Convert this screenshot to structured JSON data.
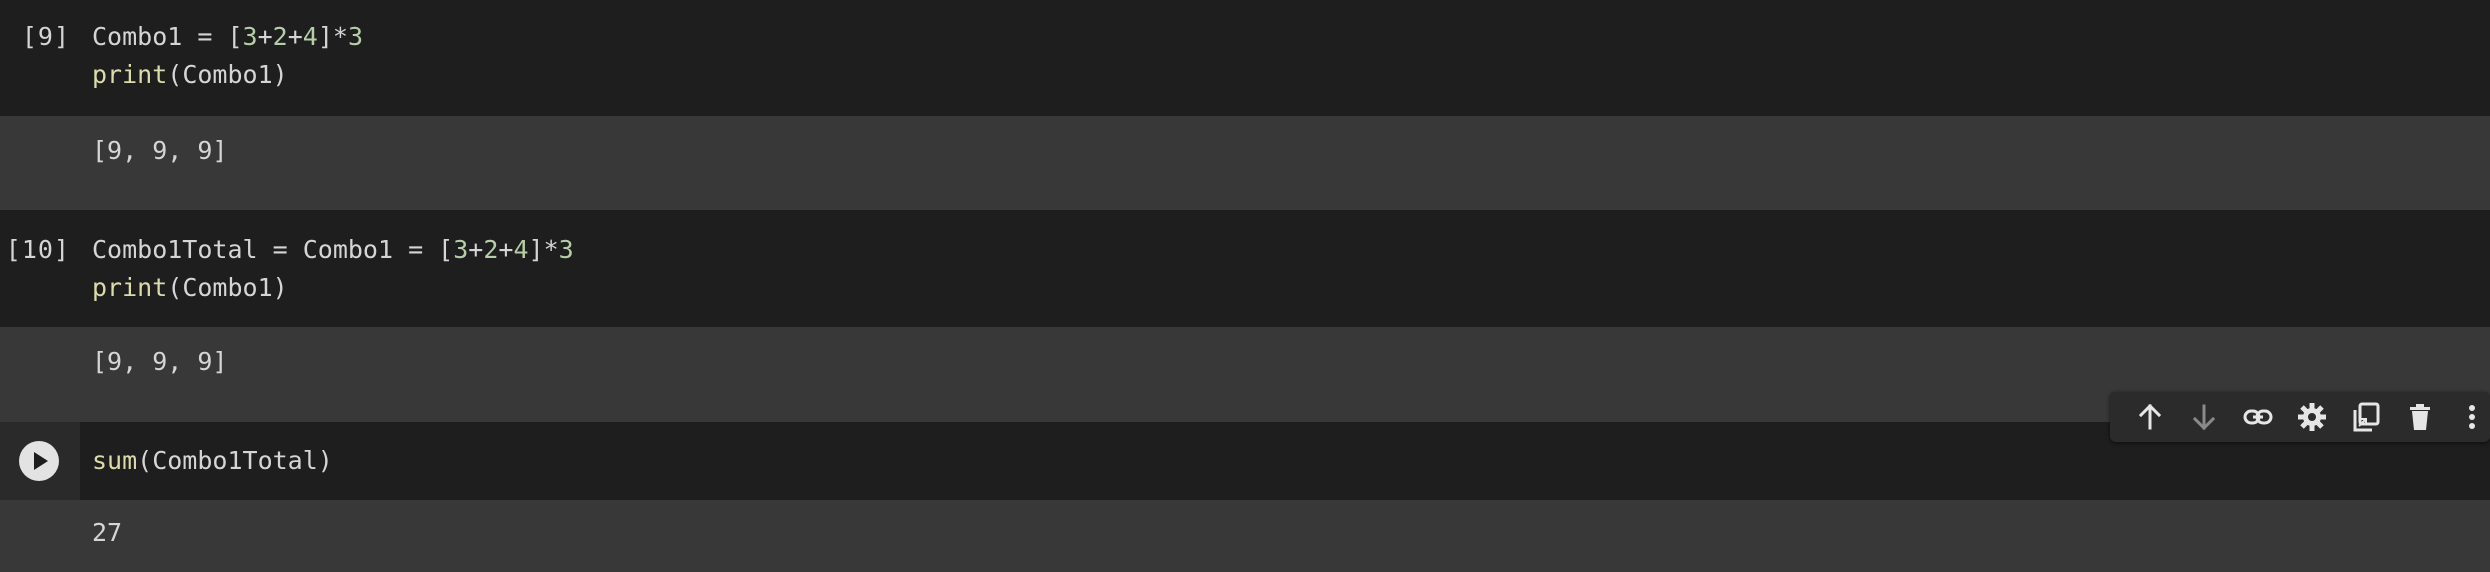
{
  "cells": [
    {
      "exec_count": "[9]",
      "lines": [
        [
          "Combo1 = [",
          "3",
          "+",
          "2",
          "+",
          "4",
          "]*",
          "3"
        ],
        [
          "print",
          "(Combo1)"
        ]
      ],
      "output": "[9, 9, 9]"
    },
    {
      "exec_count": "[10]",
      "lines": [
        [
          "Combo1Total = Combo1 = [",
          "3",
          "+",
          "2",
          "+",
          "4",
          "]*",
          "3"
        ],
        [
          "print",
          "(Combo1)"
        ]
      ],
      "output": "[9, 9, 9]"
    },
    {
      "exec_count": "",
      "lines": [
        [
          "sum",
          "(Combo1Total)"
        ]
      ],
      "output": "27"
    }
  ],
  "toolbar": {
    "icons": [
      "arrow-up-icon",
      "arrow-down-icon",
      "link-icon",
      "gear-icon",
      "mirror-cell-icon",
      "trash-icon",
      "more-vert-icon"
    ]
  },
  "colors": {
    "code_bg": "#1e1e1e",
    "output_bg": "#383838",
    "number": "#b5cea8",
    "function": "#dcdcaa",
    "text": "#d5d5d5"
  }
}
